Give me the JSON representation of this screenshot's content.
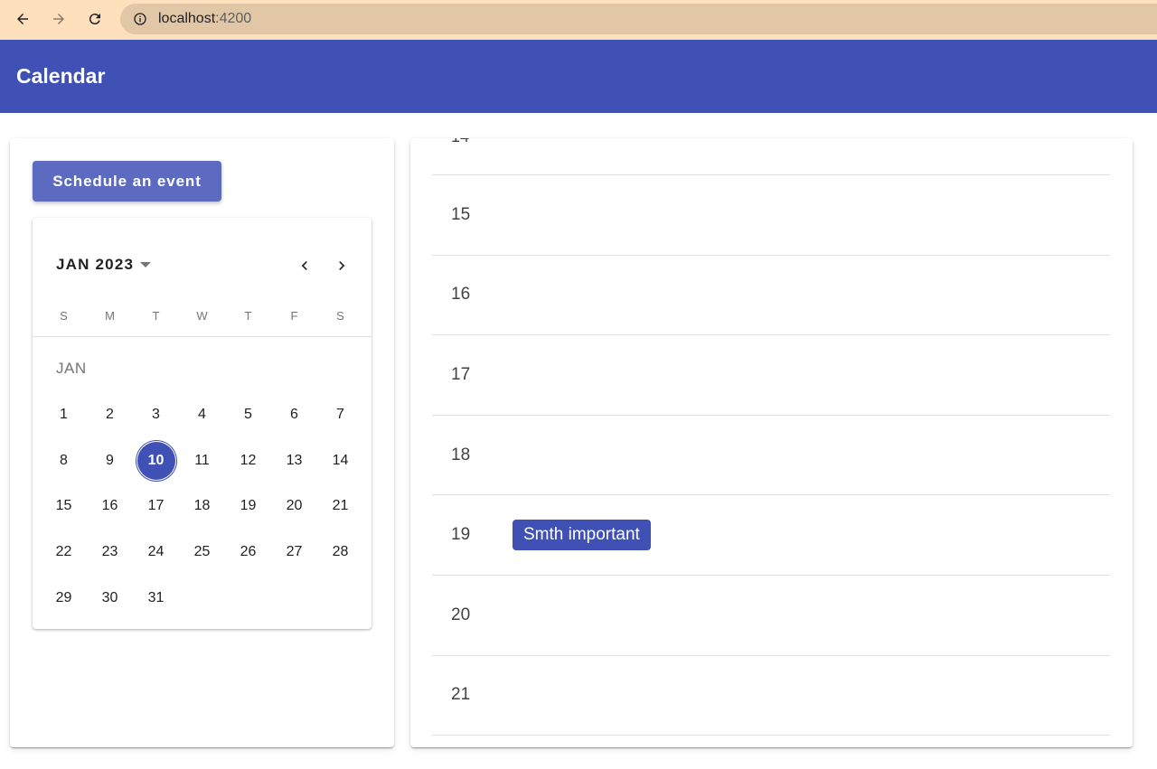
{
  "browser": {
    "url_host": "localhost",
    "url_port": ":4200"
  },
  "app": {
    "title": "Calendar"
  },
  "sidebar": {
    "schedule_button_label": "Schedule an event"
  },
  "datepicker": {
    "period_label": "JAN 2023",
    "weekdays": [
      "S",
      "M",
      "T",
      "W",
      "T",
      "F",
      "S"
    ],
    "month_label": "JAN",
    "weeks": [
      [
        "1",
        "2",
        "3",
        "4",
        "5",
        "6",
        "7"
      ],
      [
        "8",
        "9",
        "10",
        "11",
        "12",
        "13",
        "14"
      ],
      [
        "15",
        "16",
        "17",
        "18",
        "19",
        "20",
        "21"
      ],
      [
        "22",
        "23",
        "24",
        "25",
        "26",
        "27",
        "28"
      ],
      [
        "29",
        "30",
        "31",
        "",
        "",
        "",
        ""
      ]
    ],
    "selected_day": "10",
    "accent_color": "#3f51b5"
  },
  "schedule": {
    "partial_hour": "14",
    "hours": [
      {
        "label": "15",
        "event": ""
      },
      {
        "label": "16",
        "event": ""
      },
      {
        "label": "17",
        "event": ""
      },
      {
        "label": "18",
        "event": ""
      },
      {
        "label": "19",
        "event": "Smth important"
      },
      {
        "label": "20",
        "event": ""
      },
      {
        "label": "21",
        "event": ""
      }
    ]
  },
  "colors": {
    "primary": "#3f51b5",
    "button": "#5c6bc0",
    "browser_bar": "#ffe0bd"
  },
  "icons": {
    "back": "arrow-left-icon",
    "forward": "arrow-right-icon",
    "reload": "reload-icon",
    "info": "info-icon",
    "prev_month": "chevron-left-icon",
    "next_month": "chevron-right-icon",
    "period_caret": "caret-down-icon"
  }
}
